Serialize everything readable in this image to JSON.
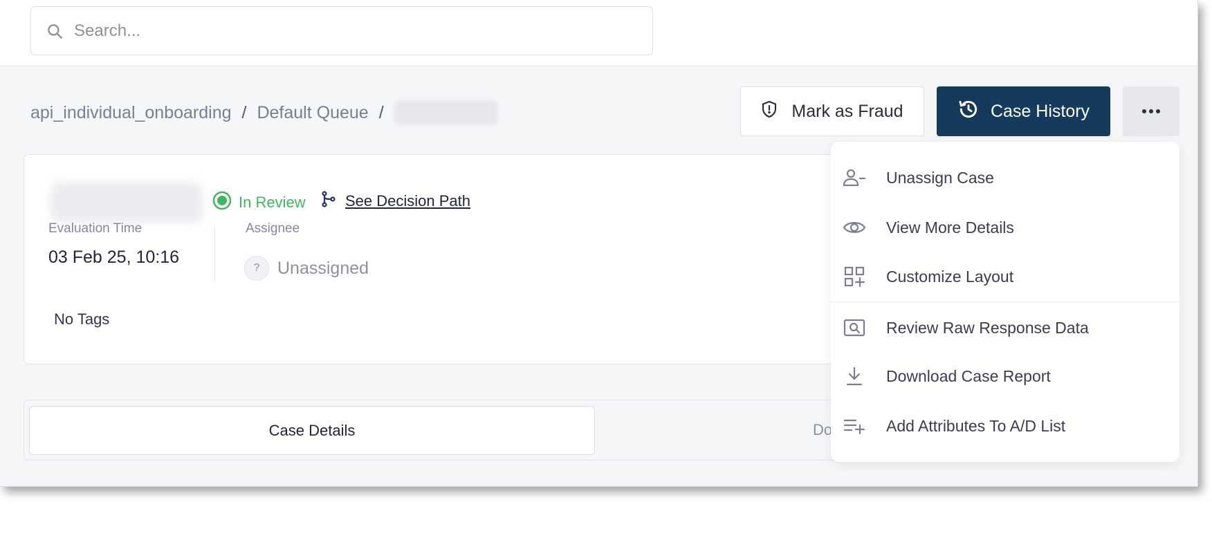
{
  "search": {
    "placeholder": "Search..."
  },
  "breadcrumb": {
    "workflow": "api_individual_onboarding",
    "queue": "Default Queue",
    "separator": "/"
  },
  "actions": {
    "mark_fraud": "Mark as Fraud",
    "case_history": "Case History"
  },
  "case": {
    "status": "In Review",
    "decision_link": "See Decision Path",
    "evaluation_time_label": "Evaluation Time",
    "evaluation_time_value": "03 Feb 25, 10:16",
    "assignee_label": "Assignee",
    "assignee_avatar": "?",
    "assignee_value": "Unassigned",
    "tags": "No Tags"
  },
  "tabs": {
    "active": "Case Details",
    "second_partial": "Do"
  },
  "menu": {
    "items": [
      {
        "label": "Unassign Case",
        "icon": "user-minus-icon"
      },
      {
        "label": "View More Details",
        "icon": "eye-icon"
      },
      {
        "label": "Customize Layout",
        "icon": "grid-plus-icon"
      },
      {
        "label": "Review Raw Response Data",
        "icon": "search-box-icon"
      },
      {
        "label": "Download Case Report",
        "icon": "download-icon"
      },
      {
        "label": "Add Attributes To A/D List",
        "icon": "playlist-add-icon"
      }
    ]
  },
  "colors": {
    "primary": "#153a5c",
    "success": "#3fb85c",
    "background": "#f5f6f8"
  }
}
